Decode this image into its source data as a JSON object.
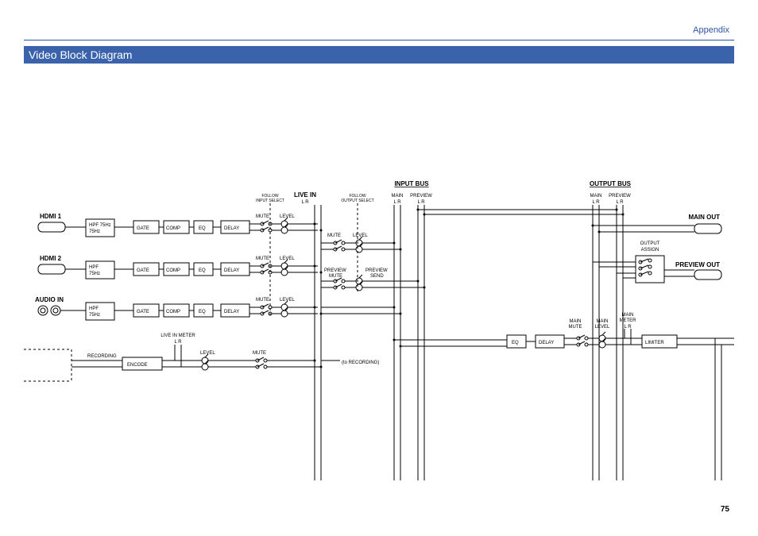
{
  "header": {
    "appendix": "Appendix",
    "title": "Video Block Diagram",
    "page": "75"
  },
  "inputs": {
    "hdmi1": "HDMI 1",
    "hdmi2": "HDMI 2",
    "audioin": "AUDIO IN"
  },
  "blocks": {
    "hpf": "HPF\n75Hz",
    "gate": "GATE",
    "comp": "COMP",
    "eq": "EQ",
    "delay": "DELAY",
    "encode": "ENCODE",
    "limiter": "LIMITER"
  },
  "labels": {
    "mute": "MUTE",
    "level": "LEVEL",
    "recording": "RECORDING",
    "liveinmeter": "LIVE IN METER",
    "lr": "L   R",
    "followin": "FOLLOW\nINPUT SELECT",
    "followout": "FOLLOW\nOUTPUT SELECT",
    "livein": "LIVE IN",
    "inputbus": "INPUT BUS",
    "outputbus": "OUTPUT BUS",
    "main": "MAIN",
    "preview": "PREVIEW",
    "previewmute": "PREVIEW\nMUTE",
    "previewsend": "PREVIEW\nSEND",
    "mainmute": "MAIN\nMUTE",
    "mainlevel": "MAIN\nLEVEL",
    "mainmeter": "MAIN\nMETER",
    "mainout": "MAIN OUT",
    "previewout": "PREVIEW OUT",
    "outputassign": "OUTPUT\nASSIGN",
    "torecording": "(to RECORDING)"
  }
}
